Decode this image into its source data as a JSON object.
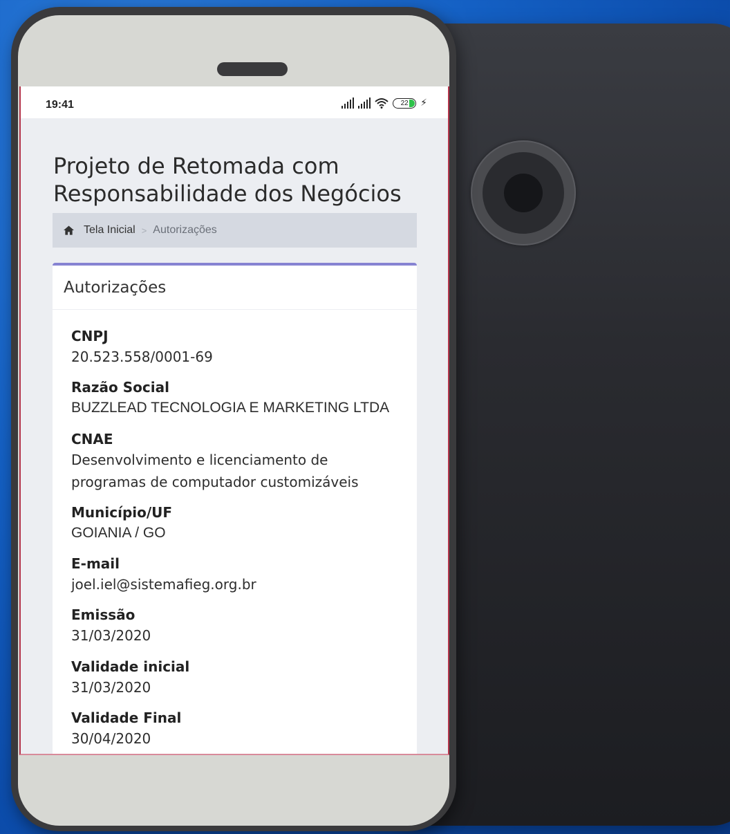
{
  "status_bar": {
    "time": "19:41",
    "battery_level": "22",
    "icons": [
      "signal-icon",
      "signal-icon",
      "wifi-icon",
      "battery-icon",
      "charging-bolt-icon"
    ]
  },
  "page": {
    "title": "Projeto de Retomada com Responsabilidade dos Negócios"
  },
  "breadcrumb": {
    "home_icon": "home-icon",
    "home_label": "Tela Inicial",
    "separator": ">",
    "current": "Autorizações"
  },
  "card": {
    "title": "Autorizações",
    "fields": [
      {
        "label": "CNPJ",
        "value": "20.523.558/0001-69"
      },
      {
        "label": "Razão Social",
        "value": "BUZZLEAD TECNOLOGIA E MARKETING LTDA"
      },
      {
        "label": "CNAE",
        "value": "Desenvolvimento e licenciamento de programas de computador customizáveis"
      },
      {
        "label": "Município/UF",
        "value": "GOIANIA / GO"
      },
      {
        "label": "E-mail",
        "value": "joel.iel@sistemafieg.org.br"
      },
      {
        "label": "Emissão",
        "value": "31/03/2020"
      },
      {
        "label": "Validade inicial",
        "value": "31/03/2020"
      },
      {
        "label": "Validade Final",
        "value": "30/04/2020"
      }
    ]
  },
  "colors": {
    "background_blue": "#1460c4",
    "card_accent": "#8683d2",
    "breadcrumb_bg": "#d5d9e1",
    "phone_frame": "#3a3a3c"
  }
}
